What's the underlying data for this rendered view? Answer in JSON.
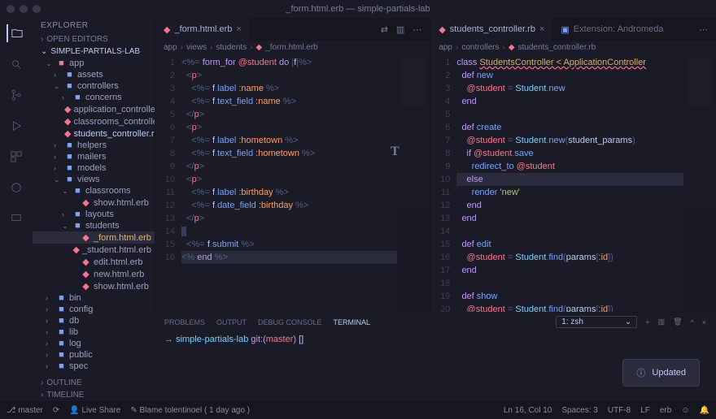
{
  "window": {
    "title": "_form.html.erb — simple-partials-lab"
  },
  "sidebar": {
    "header": "EXPLORER",
    "sections": {
      "open_editors": "OPEN EDITORS",
      "outline": "OUTLINE",
      "timeline": "TIMELINE"
    },
    "project": "SIMPLE-PARTIALS-LAB",
    "tree": [
      {
        "l": 1,
        "t": "folder-open",
        "n": "app",
        "c": "#f7768e"
      },
      {
        "l": 2,
        "t": "folder",
        "n": "assets"
      },
      {
        "l": 2,
        "t": "folder-open",
        "n": "controllers"
      },
      {
        "l": 3,
        "t": "folder",
        "n": "concerns"
      },
      {
        "l": 3,
        "t": "ruby",
        "n": "application_controller.rb"
      },
      {
        "l": 3,
        "t": "ruby",
        "n": "classrooms_controller.rb"
      },
      {
        "l": 3,
        "t": "ruby",
        "n": "students_controller.rb",
        "sel": true
      },
      {
        "l": 2,
        "t": "folder",
        "n": "helpers"
      },
      {
        "l": 2,
        "t": "folder",
        "n": "mailers"
      },
      {
        "l": 2,
        "t": "folder",
        "n": "models"
      },
      {
        "l": 2,
        "t": "folder-open",
        "n": "views"
      },
      {
        "l": 3,
        "t": "folder-open",
        "n": "classrooms"
      },
      {
        "l": 4,
        "t": "erb",
        "n": "show.html.erb"
      },
      {
        "l": 3,
        "t": "folder",
        "n": "layouts"
      },
      {
        "l": 3,
        "t": "folder-open",
        "n": "students"
      },
      {
        "l": 4,
        "t": "erb",
        "n": "_form.html.erb",
        "act": true
      },
      {
        "l": 4,
        "t": "erb",
        "n": "_student.html.erb"
      },
      {
        "l": 4,
        "t": "erb",
        "n": "edit.html.erb"
      },
      {
        "l": 4,
        "t": "erb",
        "n": "new.html.erb"
      },
      {
        "l": 4,
        "t": "erb",
        "n": "show.html.erb"
      },
      {
        "l": 1,
        "t": "folder",
        "n": "bin"
      },
      {
        "l": 1,
        "t": "folder",
        "n": "config"
      },
      {
        "l": 1,
        "t": "folder",
        "n": "db"
      },
      {
        "l": 1,
        "t": "folder",
        "n": "lib"
      },
      {
        "l": 1,
        "t": "folder",
        "n": "log"
      },
      {
        "l": 1,
        "t": "folder",
        "n": "public"
      },
      {
        "l": 1,
        "t": "folder",
        "n": "spec"
      }
    ]
  },
  "editorLeft": {
    "tab": {
      "label": "_form.html.erb",
      "icon": "ruby"
    },
    "breadcrumb": [
      "app",
      "views",
      "students",
      "_form.html.erb"
    ],
    "lines": 16
  },
  "editorRight": {
    "tabs": [
      {
        "label": "students_controller.rb",
        "icon": "ruby",
        "active": true
      },
      {
        "label": "Extension: Andromeda",
        "icon": "ext",
        "active": false
      }
    ],
    "breadcrumb": [
      "app",
      "controllers",
      "students_controller.rb"
    ],
    "lines": 28
  },
  "panel": {
    "tabs": [
      "PROBLEMS",
      "OUTPUT",
      "DEBUG CONSOLE",
      "TERMINAL"
    ],
    "active": "TERMINAL",
    "select": "1: zsh",
    "termLine": {
      "arrow": "→",
      "path": "simple-partials-lab",
      "git": "git:(",
      "branch": "master",
      "git2": ")",
      "cursor": "[]"
    }
  },
  "statusbar": {
    "left": [
      "master",
      "Live Share",
      "Blame tolentinoel ( 1 day ago )"
    ],
    "right": [
      "Ln 16, Col 10",
      "Spaces: 3",
      "UTF-8",
      "LF",
      "erb"
    ]
  },
  "toast": {
    "label": "Updated",
    "icon": "info"
  }
}
